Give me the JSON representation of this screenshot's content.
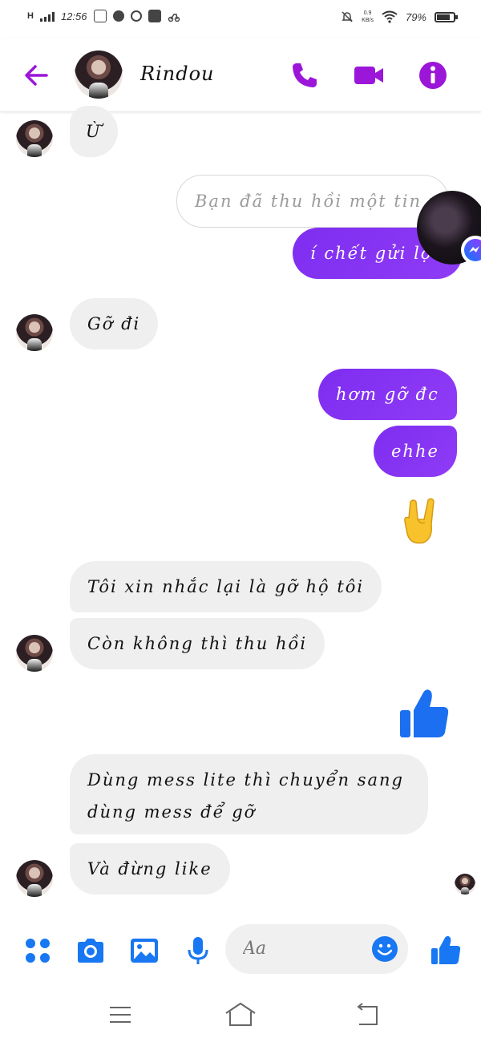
{
  "colors": {
    "accent": "#9b16d9",
    "outgoing_bubble": "#8a35f3",
    "incoming_bubble": "#efefef",
    "messenger_blue": "#1877f2"
  },
  "status_bar": {
    "network": "H",
    "time": "12:56",
    "app_icons": [
      "zalo-icon",
      "messenger-icon",
      "g-icon",
      "play-icon",
      "scooter-icon"
    ],
    "speed": "0.9",
    "speed_unit": "KB/s",
    "battery": "79%",
    "battery_level": 0.79
  },
  "header": {
    "contact_name": "Rindou",
    "icons": [
      "back-arrow-icon",
      "phone-icon",
      "video-icon",
      "info-icon"
    ]
  },
  "messages": [
    {
      "id": "m1",
      "side": "in",
      "text": "Ừ"
    },
    {
      "id": "m2",
      "side": "out",
      "unsent": true,
      "text": "Bạn đã thu hồi một tin nhắn"
    },
    {
      "id": "m3",
      "side": "out",
      "text": "í chết gửi lộn"
    },
    {
      "id": "m4",
      "side": "in",
      "text": "Gỡ đi"
    },
    {
      "id": "m5",
      "side": "out",
      "text": "hơm gỡ đc"
    },
    {
      "id": "m6",
      "side": "out",
      "text": "ehhe"
    },
    {
      "id": "m7",
      "side": "out",
      "emoji": "rock-hand-emoji"
    },
    {
      "id": "m8",
      "side": "in",
      "text": "Tôi xin nhắc lại là gỡ hộ tôi"
    },
    {
      "id": "m9",
      "side": "in",
      "text": "Còn không thì thu hồi"
    },
    {
      "id": "m10",
      "side": "out",
      "emoji": "thumbs-up-icon"
    },
    {
      "id": "m11",
      "side": "in",
      "lines": [
        "Dùng mess lite thì chuyển sang",
        "dùng mess để gỡ"
      ]
    },
    {
      "id": "m12",
      "side": "in",
      "text": "Và đừng like"
    }
  ],
  "composer": {
    "placeholder": "Aa",
    "icons": [
      "menu-grid-icon",
      "camera-icon",
      "gallery-icon",
      "mic-icon",
      "emoji-smile-icon",
      "like-icon"
    ]
  },
  "nav": {
    "icons": [
      "menu-icon",
      "home-icon",
      "back-icon"
    ]
  }
}
